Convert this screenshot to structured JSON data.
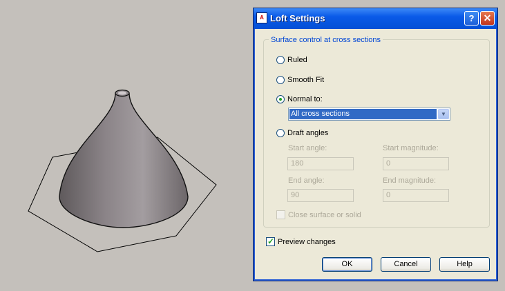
{
  "dialog": {
    "title": "Loft Settings",
    "group_title": "Surface control at cross sections",
    "options": {
      "ruled": {
        "label": "Ruled",
        "checked": false
      },
      "smooth_fit": {
        "label": "Smooth Fit",
        "checked": false
      },
      "normal_to": {
        "label": "Normal to:",
        "checked": true
      },
      "draft_angles": {
        "label": "Draft angles",
        "checked": false
      }
    },
    "normal_to_selection": "All cross sections",
    "start_angle": {
      "label": "Start angle:",
      "value": "180"
    },
    "start_magnitude": {
      "label": "Start magnitude:",
      "value": "0"
    },
    "end_angle": {
      "label": "End angle:",
      "value": "90"
    },
    "end_magnitude": {
      "label": "End magnitude:",
      "value": "0"
    },
    "close_surface": {
      "label": "Close surface or solid",
      "checked": false,
      "enabled": false
    },
    "preview_changes": {
      "label": "Preview changes",
      "checked": true
    },
    "buttons": {
      "ok": "OK",
      "cancel": "Cancel",
      "help": "Help"
    },
    "titlebar_help": "?",
    "titlebar_close": "✕"
  },
  "colors": {
    "viewport_bg": "#c4c0bb",
    "titlebar": "#0450d6",
    "dialog_bg": "#ece9d8",
    "selection": "#316ac5"
  },
  "icons": {
    "app_icon": "autocad-app-icon",
    "dropdown": "chevron-down-icon"
  }
}
